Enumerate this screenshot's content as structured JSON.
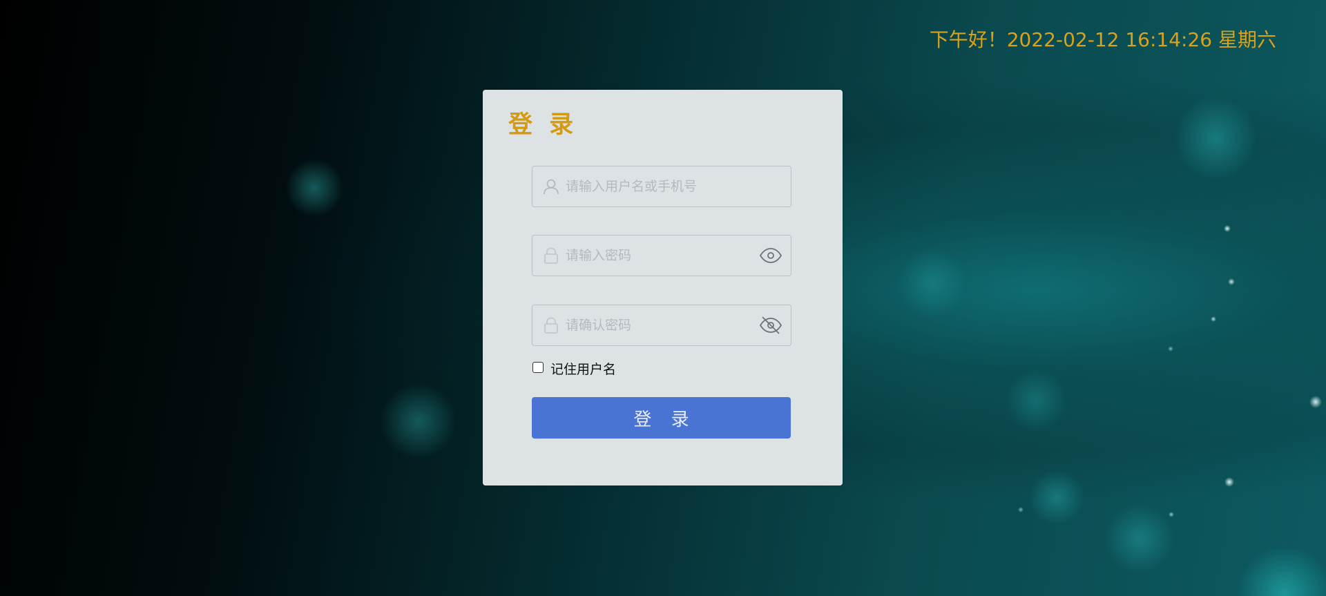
{
  "header": {
    "greeting_datetime": "下午好！2022-02-12 16:14:26 星期六"
  },
  "login_panel": {
    "title": "登 录",
    "username": {
      "placeholder": "请输入用户名或手机号",
      "value": "",
      "icon": "user-icon"
    },
    "password": {
      "placeholder": "请输入密码",
      "value": "",
      "icon": "lock-icon",
      "toggle_icon": "eye-icon"
    },
    "confirm_password": {
      "placeholder": "请确认密码",
      "value": "",
      "icon": "lock-icon",
      "toggle_icon": "eye-off-icon"
    },
    "remember": {
      "label": "记住用户名",
      "checked": false
    },
    "submit_label": "登 录"
  },
  "colors": {
    "accent_gold": "#d9a21a",
    "button_blue": "#4a74d4",
    "panel_bg": "#dde3e5"
  }
}
